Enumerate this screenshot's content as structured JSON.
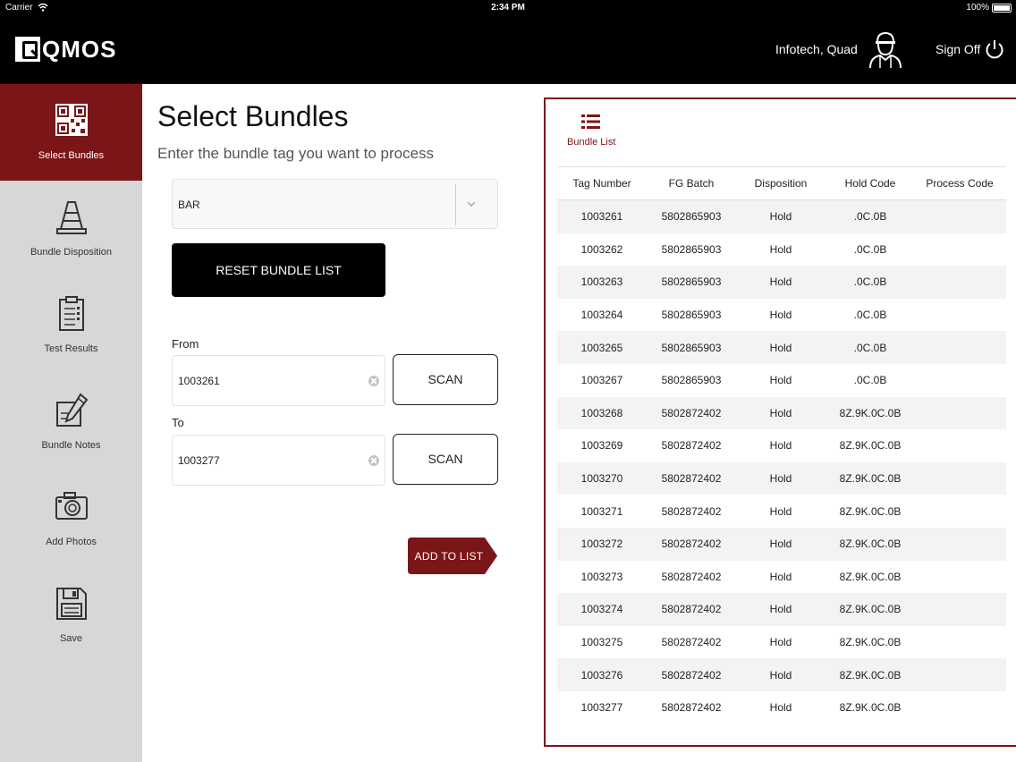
{
  "status_bar": {
    "carrier": "Carrier",
    "time": "2:34 PM",
    "battery": "100%"
  },
  "header": {
    "logo": "QMOS",
    "user_name": "Infotech, Quad",
    "sign_off": "Sign Off"
  },
  "sidebar": {
    "items": [
      {
        "label": "Select Bundles",
        "icon": "qr-code-icon",
        "active": true
      },
      {
        "label": "Bundle Disposition",
        "icon": "traffic-cone-icon",
        "active": false
      },
      {
        "label": "Test Results",
        "icon": "clipboard-icon",
        "active": false
      },
      {
        "label": "Bundle Notes",
        "icon": "notes-pencil-icon",
        "active": false
      },
      {
        "label": "Add Photos",
        "icon": "camera-icon",
        "active": false
      },
      {
        "label": "Save",
        "icon": "floppy-disk-icon",
        "active": false
      }
    ]
  },
  "main": {
    "title": "Select Bundles",
    "subtitle": "Enter the bundle tag you want to process",
    "dropdown_value": "BAR",
    "reset_label": "RESET BUNDLE LIST",
    "from_label": "From",
    "from_value": "1003261",
    "to_label": "To",
    "to_value": "1003277",
    "scan_label": "SCAN",
    "add_label": "ADD TO LIST"
  },
  "bundle_list": {
    "label": "Bundle List",
    "columns": [
      "Tag Number",
      "FG Batch",
      "Disposition",
      "Hold Code",
      "Process Code"
    ],
    "rows": [
      [
        "1003261",
        "5802865903",
        "Hold",
        ".0C.0B",
        ""
      ],
      [
        "1003262",
        "5802865903",
        "Hold",
        ".0C.0B",
        ""
      ],
      [
        "1003263",
        "5802865903",
        "Hold",
        ".0C.0B",
        ""
      ],
      [
        "1003264",
        "5802865903",
        "Hold",
        ".0C.0B",
        ""
      ],
      [
        "1003265",
        "5802865903",
        "Hold",
        ".0C.0B",
        ""
      ],
      [
        "1003267",
        "5802865903",
        "Hold",
        ".0C.0B",
        ""
      ],
      [
        "1003268",
        "5802872402",
        "Hold",
        "8Z.9K.0C.0B",
        ""
      ],
      [
        "1003269",
        "5802872402",
        "Hold",
        "8Z.9K.0C.0B",
        ""
      ],
      [
        "1003270",
        "5802872402",
        "Hold",
        "8Z.9K.0C.0B",
        ""
      ],
      [
        "1003271",
        "5802872402",
        "Hold",
        "8Z.9K.0C.0B",
        ""
      ],
      [
        "1003272",
        "5802872402",
        "Hold",
        "8Z.9K.0C.0B",
        ""
      ],
      [
        "1003273",
        "5802872402",
        "Hold",
        "8Z.9K.0C.0B",
        ""
      ],
      [
        "1003274",
        "5802872402",
        "Hold",
        "8Z.9K.0C.0B",
        ""
      ],
      [
        "1003275",
        "5802872402",
        "Hold",
        "8Z.9K.0C.0B",
        ""
      ],
      [
        "1003276",
        "5802872402",
        "Hold",
        "8Z.9K.0C.0B",
        ""
      ],
      [
        "1003277",
        "5802872402",
        "Hold",
        "8Z.9K.0C.0B",
        ""
      ]
    ]
  },
  "colors": {
    "accent": "#7a1618",
    "header_bg": "#000000",
    "sidebar_bg": "#d7d7d7"
  }
}
